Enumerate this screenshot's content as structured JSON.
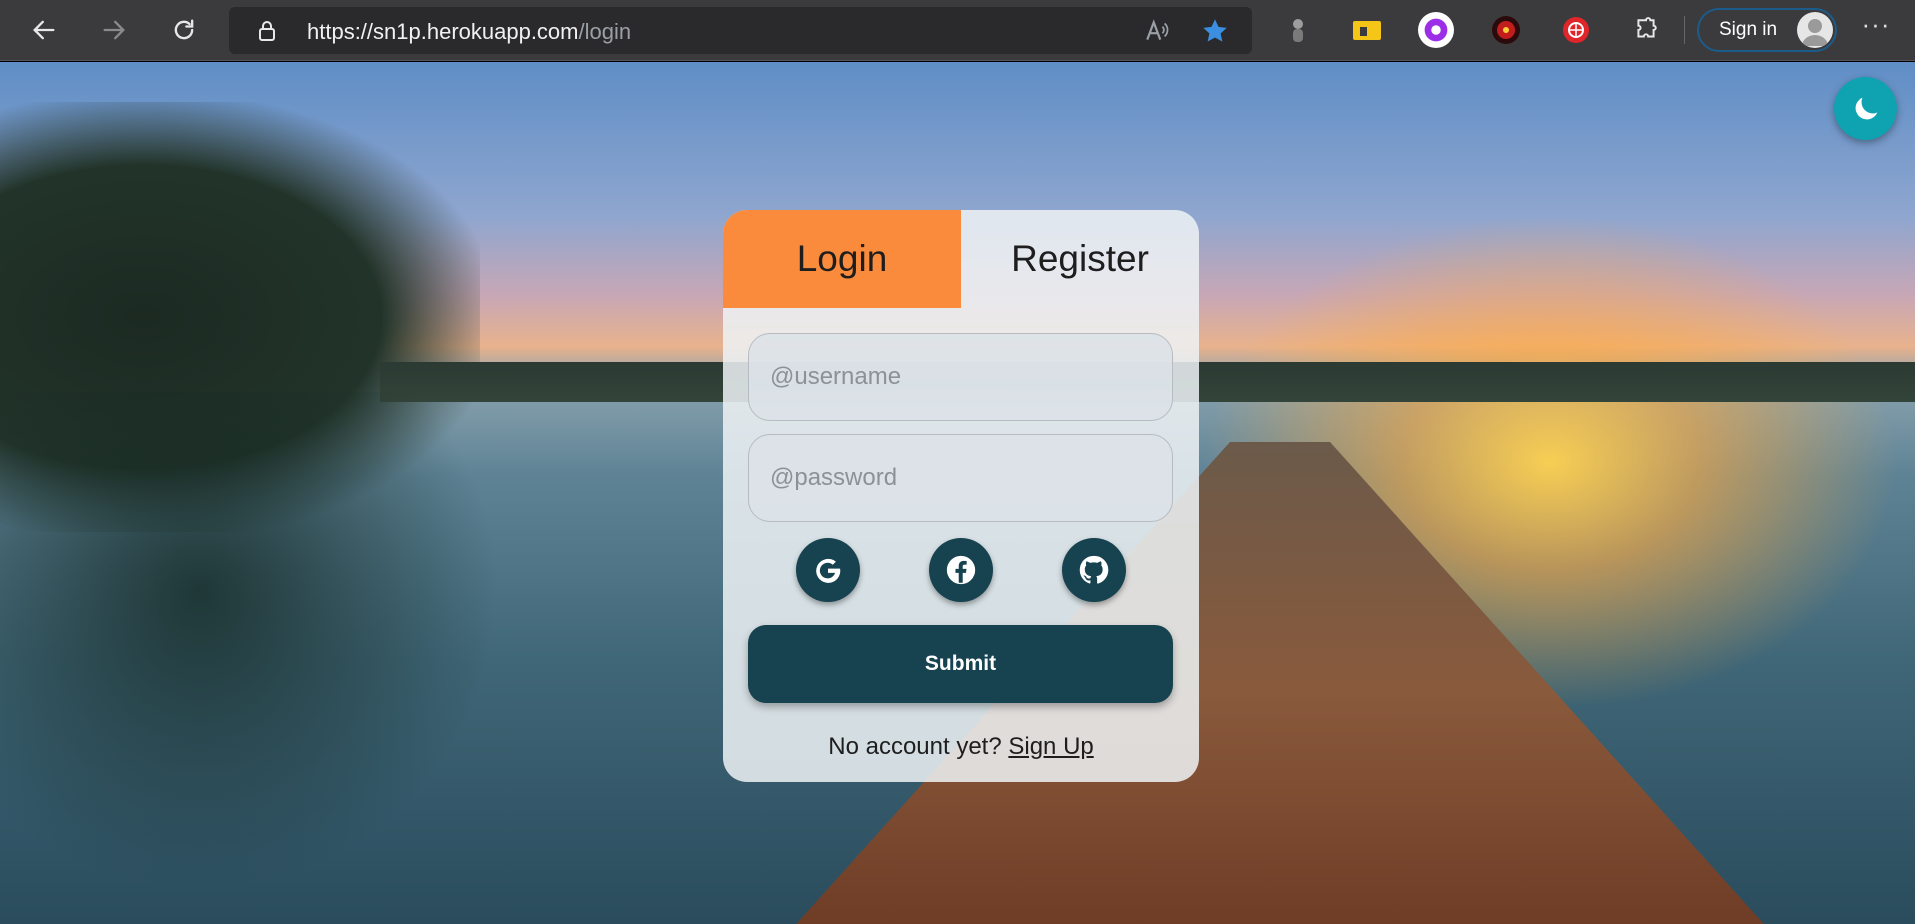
{
  "browser": {
    "url_host": "https://sn1p.herokuapp.com",
    "url_path": "/login",
    "signin_label": "Sign in",
    "more_label": "···"
  },
  "login": {
    "tab_login": "Login",
    "tab_register": "Register",
    "username_placeholder": "@username",
    "password_placeholder": "@password",
    "social_icons": [
      "google-icon",
      "facebook-icon",
      "github-icon"
    ],
    "submit_label": "Submit",
    "no_account_text": "No account yet?",
    "signup_link": "Sign Up"
  },
  "colors": {
    "accent_tab": "#fb8b3c",
    "button_dark": "#17424f",
    "theme_toggle": "#0fa3b1"
  }
}
